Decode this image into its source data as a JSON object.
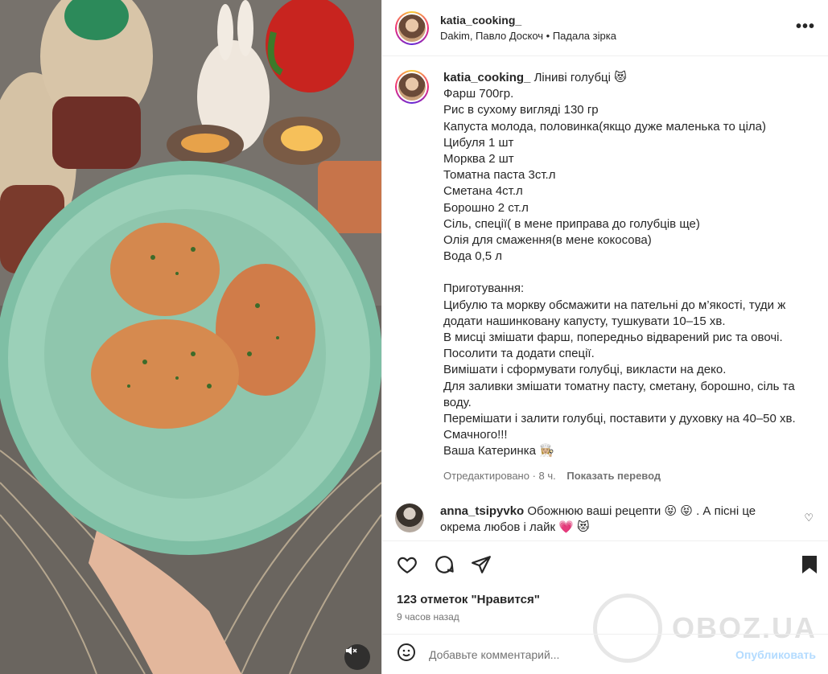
{
  "header": {
    "username": "katia_cooking_",
    "audio": "Dakim, Павло Доскоч • Падала зірка",
    "more": "•••"
  },
  "caption": {
    "username": "katia_cooking_",
    "title": "Ліниві голубці 😻",
    "lines": [
      "Фарш 700гр.",
      "Рис в сухому вигляді 130 гр",
      "Капуста молода, половинка(якщо дуже маленька то ціла)",
      "Цибуля 1 шт",
      "Морква 2 шт",
      "Томатна паста 3ст.л",
      "Сметана 4ст.л",
      "Борошно 2 ст.л",
      "Сіль, спеції( в мене приправа до голубців ще)",
      "Олія для смаження(в мене кокосова)",
      "Вода 0,5 л",
      "",
      "Приготування:",
      "Цибулю та моркву обсмажити на пательні до м’якості, туди ж додати нашинковану капусту, тушкувати 10–15 хв.",
      "В мисці змішати фарш, попередньо відварений рис та овочі. Посолити та додати спеції.",
      "Вимішати і сформувати голубці, викласти на деко.",
      "Для заливки змішати томатну пасту, сметану, борошно, сіль та воду.",
      "Перемішати і залити голубці, поставити у духовку на 40–50 хв.",
      "Смачного!!!",
      "Ваша Катеринка 👩🏼‍🍳"
    ],
    "edited": "Отредактировано · 8 ч.",
    "translate": "Показать перевод"
  },
  "comment": {
    "username": "anna_tsipyvko",
    "text": "Обожнюю ваші рецепти 😝 😝 . А пісні це окрема любов і лайк 💗 😻",
    "heart": "♡"
  },
  "actions": {
    "likes": "123 отметок \"Нравится\"",
    "time": "9 часов назад"
  },
  "add_comment": {
    "placeholder": "Добавьте комментарий...",
    "publish": "Опубликовать"
  },
  "watermark": "OBOZ.UA"
}
